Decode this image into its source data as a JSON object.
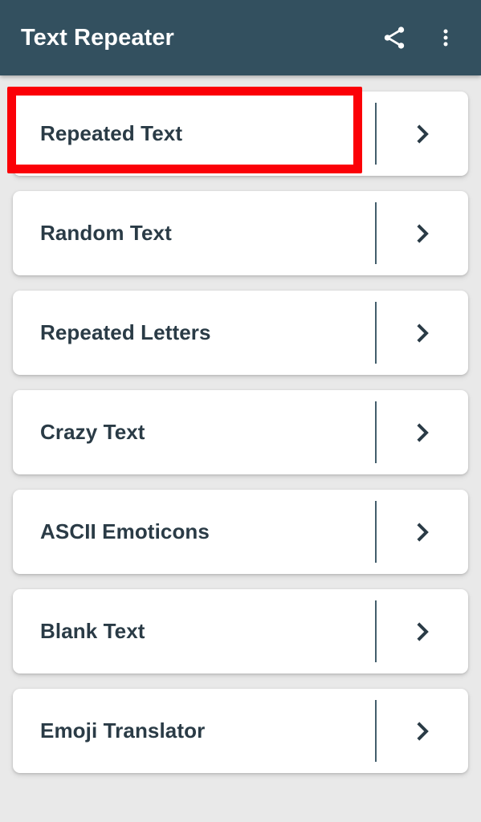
{
  "app_bar": {
    "title": "Text Repeater",
    "background_color": "#33505f",
    "title_color": "#ffffff",
    "actions": [
      {
        "name": "share-icon",
        "label": "Share"
      },
      {
        "name": "overflow-menu-icon",
        "label": "More options"
      }
    ]
  },
  "theme": {
    "page_background": "#e9e9e9",
    "card_background": "#ffffff",
    "card_text_color": "#2a3b46",
    "divider_color": "#33505f",
    "chevron_color": "#2a3b46",
    "highlight_color": "#fb0007"
  },
  "main": {
    "cards": [
      {
        "label": "Repeated Text",
        "chevron": "chevron-right-icon",
        "highlighted": true
      },
      {
        "label": "Random Text",
        "chevron": "chevron-right-icon",
        "highlighted": false
      },
      {
        "label": "Repeated Letters",
        "chevron": "chevron-right-icon",
        "highlighted": false
      },
      {
        "label": "Crazy Text",
        "chevron": "chevron-right-icon",
        "highlighted": false
      },
      {
        "label": "ASCII Emoticons",
        "chevron": "chevron-right-icon",
        "highlighted": false
      },
      {
        "label": "Blank Text",
        "chevron": "chevron-right-icon",
        "highlighted": false
      },
      {
        "label": "Emoji Translator",
        "chevron": "chevron-right-icon",
        "highlighted": false
      }
    ]
  },
  "annotation": {
    "name": "highlight-box",
    "target_label": "Repeated Text"
  }
}
